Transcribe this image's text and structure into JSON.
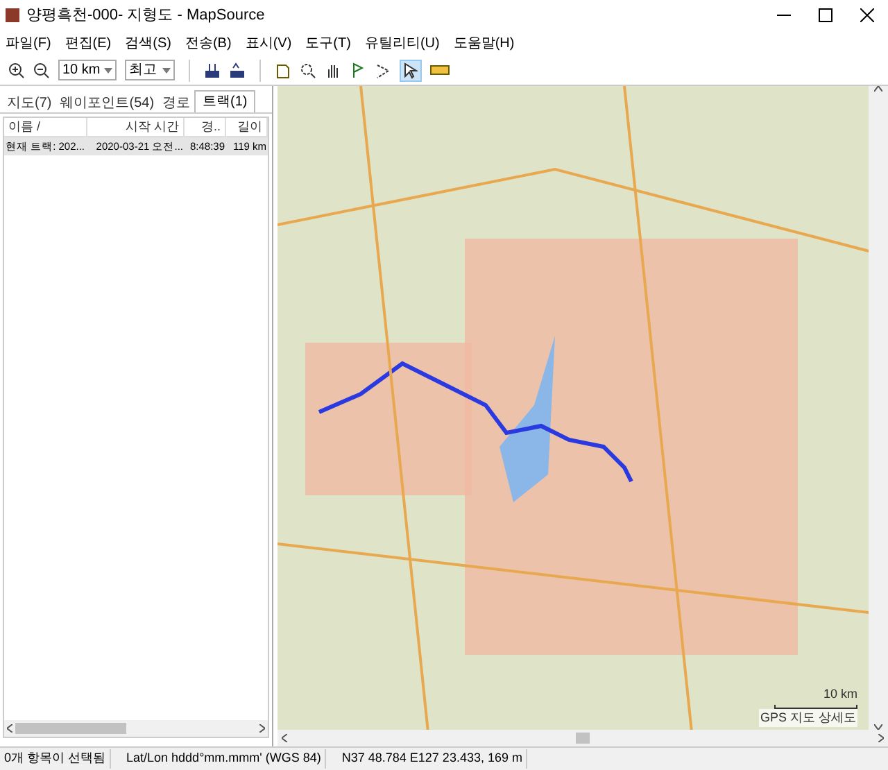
{
  "window": {
    "title": "양평흑천-000- 지형도 - MapSource"
  },
  "menu": [
    "파일(F)",
    "편집(E)",
    "검색(S)",
    "전송(B)",
    "표시(V)",
    "도구(T)",
    "유틸리티(U)",
    "도움말(H)"
  ],
  "toolbar": {
    "scale": "10 km",
    "detail": "최고"
  },
  "tabs": [
    {
      "label": "지도(7)",
      "selected": false
    },
    {
      "label": "웨이포인트(54)",
      "selected": false
    },
    {
      "label": "경로",
      "selected": false
    },
    {
      "label": "트랙(1)",
      "selected": true
    }
  ],
  "table": {
    "columns": [
      "이름 /",
      "시작 시간",
      "경..",
      "길이"
    ],
    "rows": [
      {
        "cells": [
          "현재 트랙: 202...",
          "2020-03-21 오전...",
          "8:48:39",
          "119 km"
        ],
        "selected": false
      }
    ]
  },
  "map": {
    "scale_label": "10 km",
    "detail_label": "GPS 지도 상세도"
  },
  "status_bar": [
    "0개 항목이 선택됨",
    "Lat/Lon hddd°mm.mmm' (WGS 84)",
    "N37 48.784 E127 23.433, 169 m"
  ]
}
